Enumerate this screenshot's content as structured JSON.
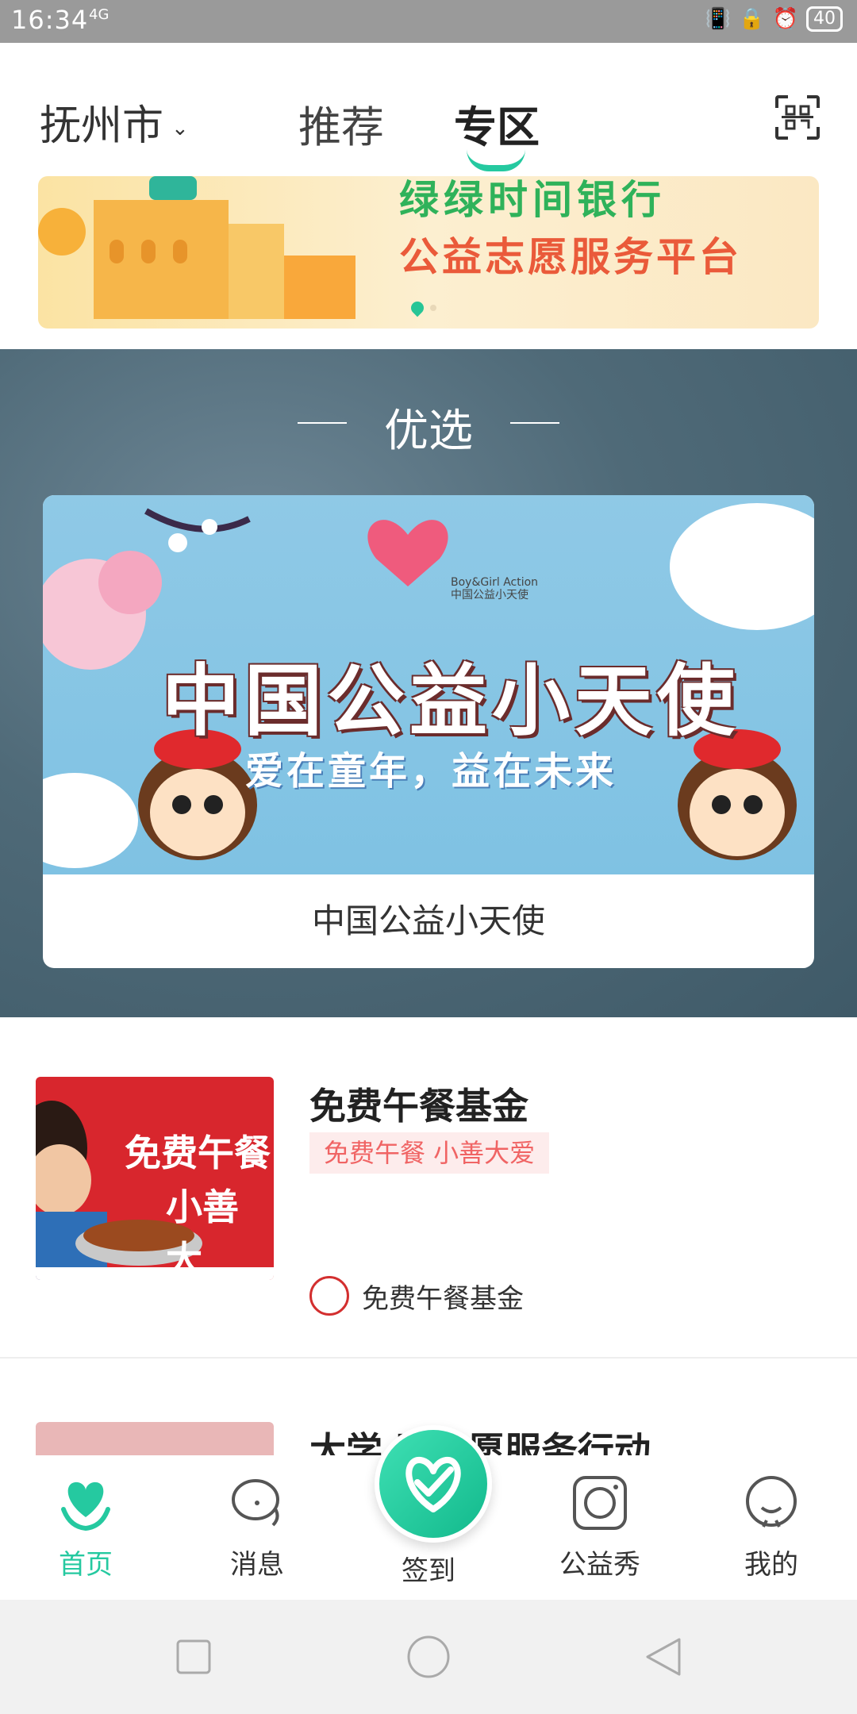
{
  "status_bar": {
    "time": "16:34",
    "signal": "4G",
    "battery": "40"
  },
  "header": {
    "city": "抚州市",
    "tabs": [
      {
        "label": "推荐",
        "active": false
      },
      {
        "label": "专区",
        "active": true
      }
    ],
    "scan_icon": "scan-icon"
  },
  "banner": {
    "line1": "绿绿时间银行",
    "line2": "公益志愿服务平台"
  },
  "featured": {
    "section_title": "优选",
    "card": {
      "image_title": "中国公益小天使",
      "image_subtitle": "爱在童年，益在未来",
      "logo_text_en": "Boy&Girl Action",
      "logo_text_cn": "中国公益小天使",
      "caption": "中国公益小天使"
    }
  },
  "list": [
    {
      "thumb_line1": "免费午餐",
      "thumb_line2": "小善大",
      "title": "免费午餐基金",
      "tag": "免费午餐  小善大爱",
      "org": "免费午餐基金"
    },
    {
      "title": "大学  区志愿服务行动"
    }
  ],
  "tabbar": {
    "items": [
      {
        "label": "首页",
        "icon": "home-heart-icon",
        "active": true
      },
      {
        "label": "消息",
        "icon": "message-icon",
        "active": false
      },
      {
        "label": "签到",
        "icon": "checkin-icon",
        "active": false
      },
      {
        "label": "公益秀",
        "icon": "camera-icon",
        "active": false
      },
      {
        "label": "我的",
        "icon": "profile-icon",
        "active": false
      }
    ]
  },
  "colors": {
    "accent": "#25c9a0",
    "tag_bg": "#fdecec",
    "tag_text": "#f06464"
  }
}
